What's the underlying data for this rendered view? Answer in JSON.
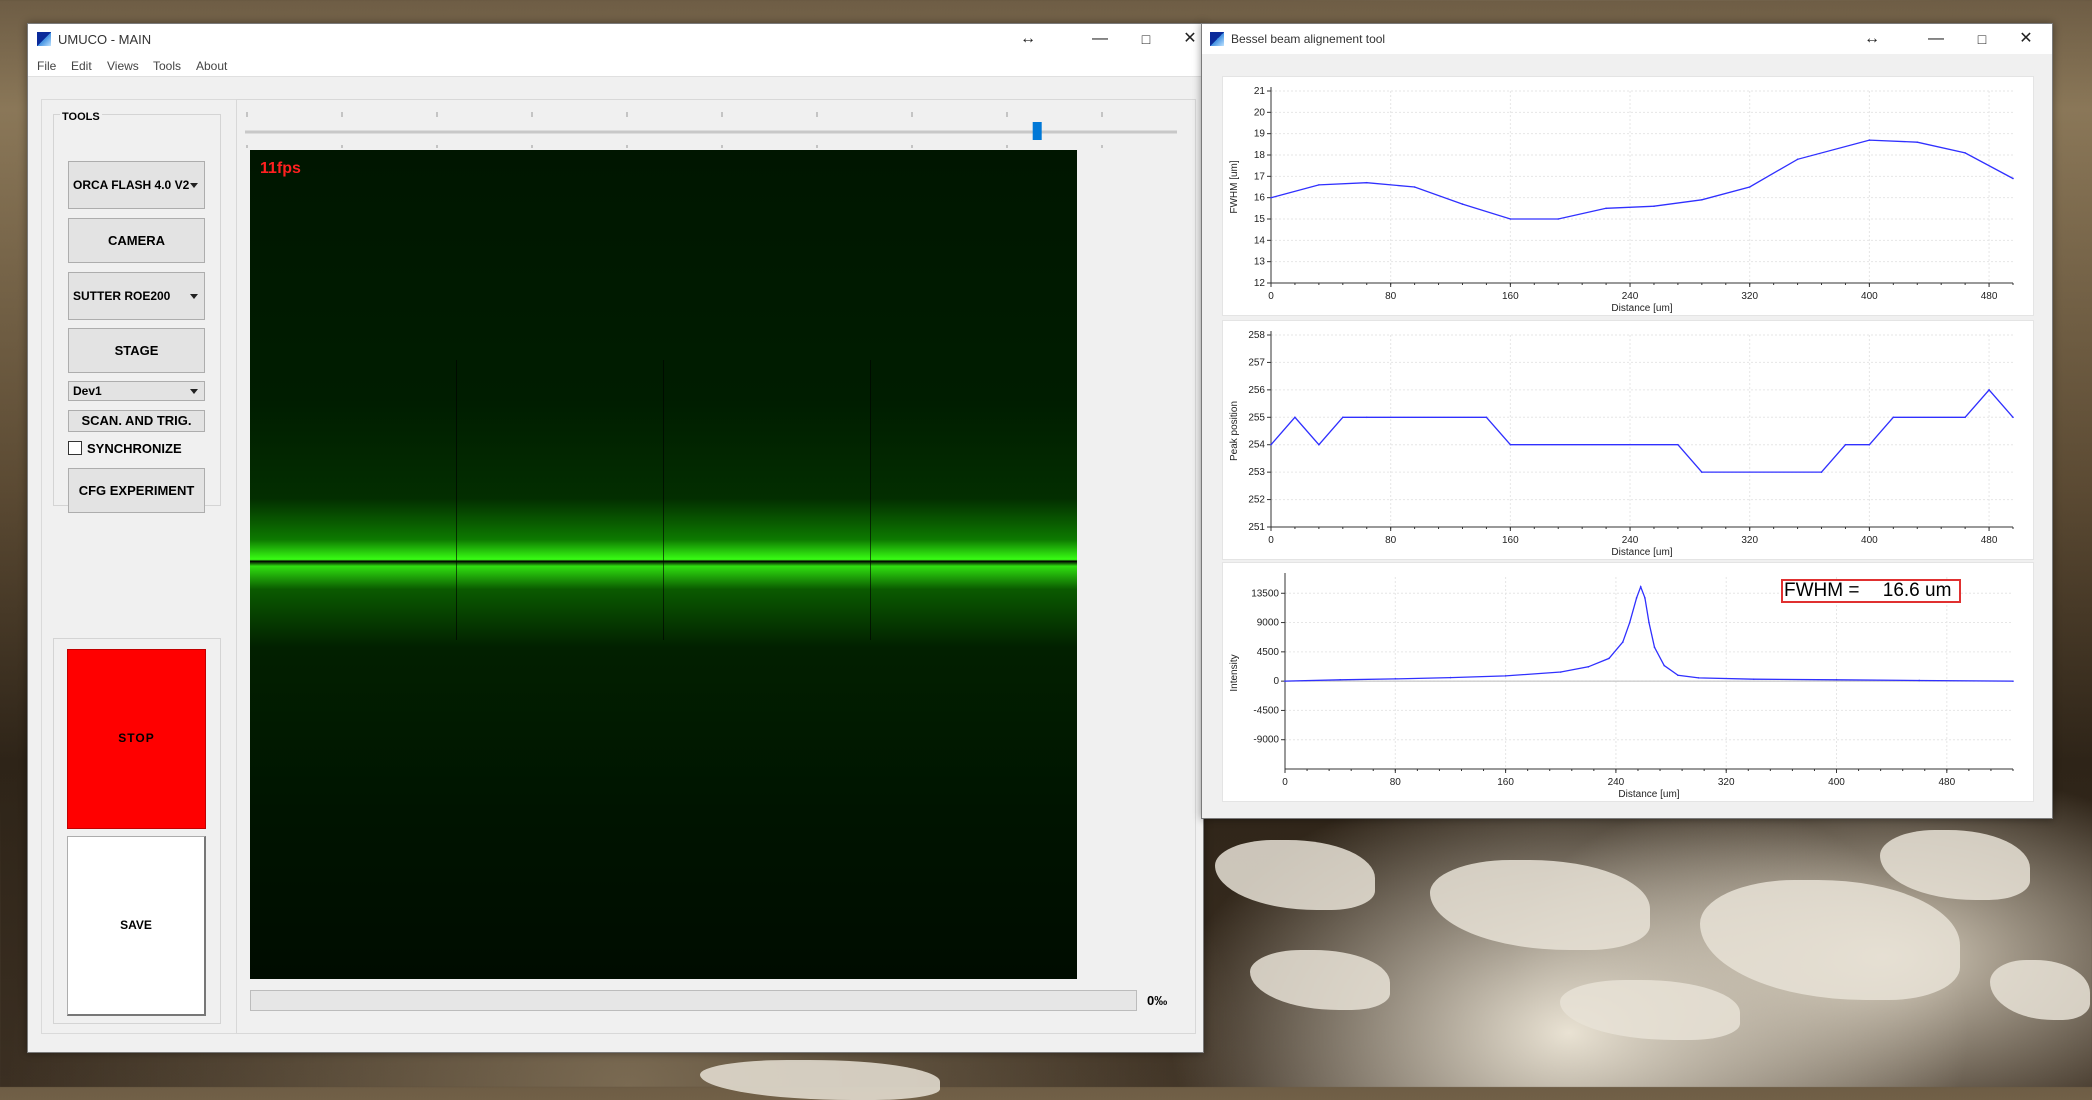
{
  "main_window": {
    "title": "UMUCO - MAIN",
    "menu": [
      "File",
      "Edit",
      "Views",
      "Tools",
      "About"
    ],
    "tools": {
      "group_label": "TOOLS",
      "camera_select": "ORCA FLASH 4.0 V2",
      "camera_button": "CAMERA",
      "stage_select": "SUTTER ROE200",
      "stage_button": "STAGE",
      "device_select": "Dev1",
      "scan_button": "SCAN. AND TRIG.",
      "sync_label": "SYNCHRONIZE",
      "sync_checked": false,
      "cfg_button": "CFG EXPERIMENT"
    },
    "stop_button": "STOP",
    "save_button": "SAVE",
    "fps": "11fps",
    "progress_text": "0‰",
    "progress_value": 0,
    "slider_value": 0.85,
    "colors": {
      "stop": "#ff0000",
      "fps": "#ff2020",
      "beam": "#39ff14",
      "accent": "#0078d7"
    }
  },
  "bessel_window": {
    "title": "Bessel beam alignement tool",
    "fwhm_label": "FWHM =",
    "fwhm_value": "16.6 um",
    "chart_data": [
      {
        "type": "line",
        "xlabel": "Distance [um]",
        "ylabel": "FWHM [um]",
        "xlim": [
          0,
          496
        ],
        "ylim": [
          12,
          21
        ],
        "xticks": [
          0,
          80,
          160,
          240,
          320,
          400,
          480
        ],
        "yticks": [
          12,
          13,
          14,
          15,
          16,
          17,
          18,
          19,
          20,
          21
        ],
        "x": [
          0,
          32,
          64,
          96,
          128,
          160,
          192,
          224,
          256,
          288,
          320,
          352,
          400,
          432,
          464,
          496
        ],
        "y": [
          16.0,
          16.6,
          16.7,
          16.5,
          15.7,
          15.0,
          15.0,
          15.5,
          15.6,
          15.9,
          16.5,
          17.8,
          18.7,
          18.6,
          18.1,
          16.9
        ],
        "color": "#3030ff"
      },
      {
        "type": "line",
        "xlabel": "Distance [um]",
        "ylabel": "Peak position",
        "xlim": [
          0,
          496
        ],
        "ylim": [
          251,
          258
        ],
        "xticks": [
          0,
          80,
          160,
          240,
          320,
          400,
          480
        ],
        "yticks": [
          251,
          252,
          253,
          254,
          255,
          256,
          257,
          258
        ],
        "x": [
          0,
          16,
          32,
          48,
          64,
          144,
          160,
          272,
          288,
          368,
          384,
          400,
          416,
          464,
          480,
          496
        ],
        "y": [
          254,
          255,
          254,
          255,
          255,
          255,
          254,
          254,
          253,
          253,
          254,
          254,
          255,
          255,
          256,
          255
        ],
        "color": "#3030ff"
      },
      {
        "type": "line",
        "xlabel": "Distance [um]",
        "ylabel": "Intensity",
        "xlim": [
          0,
          528
        ],
        "ylim": [
          -13500,
          16000
        ],
        "xticks": [
          0,
          80,
          160,
          240,
          320,
          400,
          480
        ],
        "yticks": [
          13500,
          9000,
          4500,
          0,
          -4500,
          -9000
        ],
        "x": [
          0,
          40,
          80,
          120,
          160,
          200,
          220,
          235,
          245,
          250,
          255,
          258,
          261,
          264,
          268,
          275,
          285,
          300,
          340,
          400,
          460,
          528
        ],
        "y": [
          0,
          200,
          350,
          550,
          800,
          1400,
          2200,
          3500,
          6000,
          9000,
          12800,
          14500,
          12800,
          9000,
          5200,
          2400,
          900,
          500,
          300,
          200,
          100,
          0
        ],
        "color": "#3030ff"
      }
    ]
  }
}
